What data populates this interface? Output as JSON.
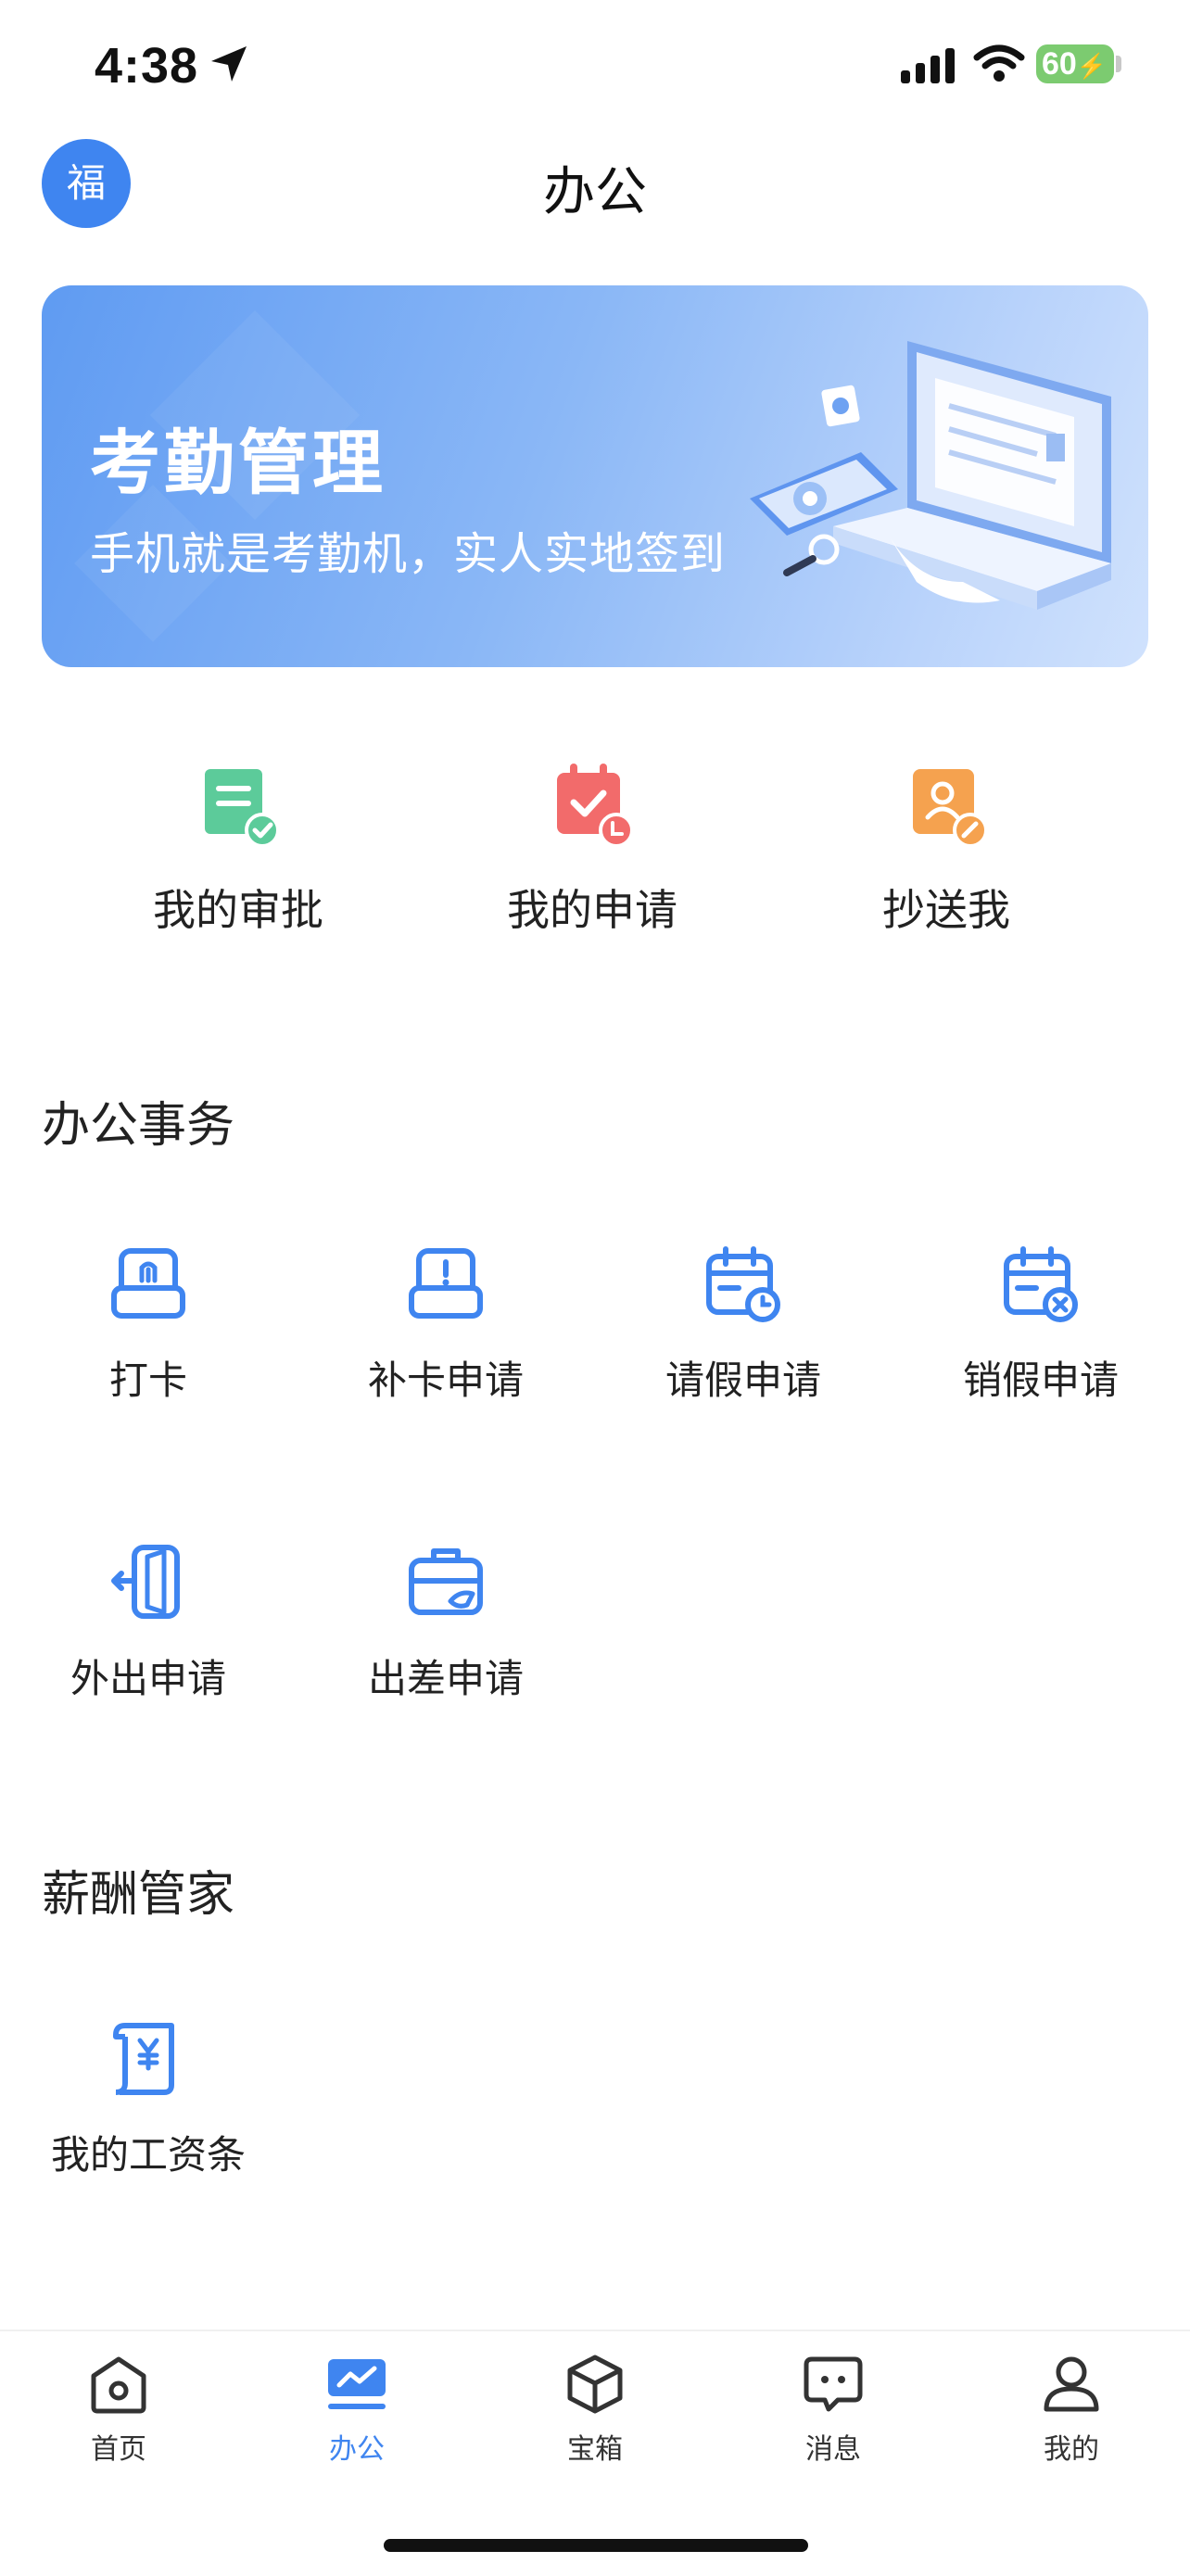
{
  "status_bar": {
    "time": "4:38",
    "battery": "60"
  },
  "header": {
    "avatar_char": "福",
    "title": "办公"
  },
  "banner": {
    "title": "考勤管理",
    "subtitle": "手机就是考勤机，实人实地签到"
  },
  "quick_actions": [
    {
      "label": "我的审批",
      "icon": "approval-doc-icon"
    },
    {
      "label": "我的申请",
      "icon": "application-calendar-icon"
    },
    {
      "label": "抄送我",
      "icon": "cc-person-icon"
    }
  ],
  "office": {
    "title": "办公事务",
    "items": [
      {
        "label": "打卡",
        "icon": "fingerprint-clock-icon"
      },
      {
        "label": "补卡申请",
        "icon": "makeup-clock-icon"
      },
      {
        "label": "请假申请",
        "icon": "leave-calendar-icon"
      },
      {
        "label": "销假申请",
        "icon": "cancel-leave-calendar-icon"
      },
      {
        "label": "外出申请",
        "icon": "go-out-door-icon"
      },
      {
        "label": "出差申请",
        "icon": "business-trip-briefcase-icon"
      }
    ]
  },
  "salary": {
    "title": "薪酬管家",
    "items": [
      {
        "label": "我的工资条",
        "icon": "payslip-scroll-icon"
      }
    ]
  },
  "tabbar": {
    "items": [
      {
        "label": "首页",
        "icon": "home-icon"
      },
      {
        "label": "办公",
        "icon": "office-chart-icon"
      },
      {
        "label": "宝箱",
        "icon": "box-icon"
      },
      {
        "label": "消息",
        "icon": "message-icon"
      },
      {
        "label": "我的",
        "icon": "profile-icon"
      }
    ],
    "active_index": 1
  },
  "colors": {
    "accent": "#3f85f0",
    "icon_blue": "#3f85f0",
    "approval_green": "#5ccb9a",
    "application_red": "#f26b6b",
    "cc_orange": "#f5a24f"
  }
}
